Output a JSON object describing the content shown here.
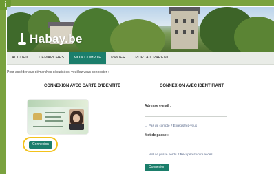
{
  "site": {
    "logo_text": "Habay.be"
  },
  "badge": {
    "label": "i"
  },
  "nav": {
    "items": [
      {
        "label": "ACCUEIL"
      },
      {
        "label": "DÉMARCHES"
      },
      {
        "label": "MON COMPTE",
        "active": true
      },
      {
        "label": "PANIER"
      },
      {
        "label": "PORTAIL PARENT"
      }
    ]
  },
  "intro_text": "Pour accéder aux démarches sécurisées, veuillez vous connecter :",
  "eid_section": {
    "title": "CONNEXION AVEC CARTE D'IDENTITÉ",
    "button_label": "Connexion"
  },
  "login_section": {
    "title": "CONNEXION AVEC IDENTIFIANT",
    "email_label": "Adresse e-mail :",
    "register_link": "→ Pas de compte ? Enregistrez-vous",
    "password_label": "Mot de passe :",
    "forgot_link": "→ Mot de passe perdu ? Récupérez votre accès",
    "button_label": "Connexion"
  },
  "colors": {
    "accent": "#1b7e6b",
    "frame_green": "#7aa23f",
    "highlight": "#f3c21b"
  }
}
